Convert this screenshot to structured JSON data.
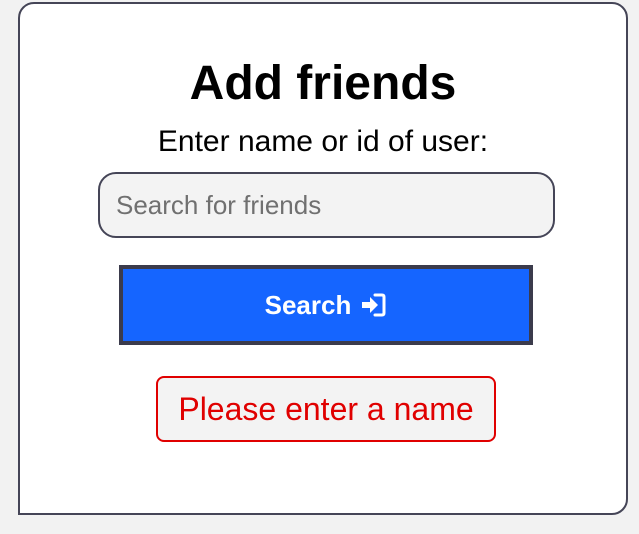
{
  "card": {
    "title": "Add friends",
    "subtitle": "Enter name or id of user:",
    "search": {
      "placeholder": "Search for friends",
      "value": ""
    },
    "search_button": {
      "label": "Search",
      "icon": "sign-in-arrow-icon"
    },
    "error_message": "Please enter a name"
  },
  "colors": {
    "button_bg": "#1565ff",
    "error": "#e00000",
    "border": "#454557"
  }
}
